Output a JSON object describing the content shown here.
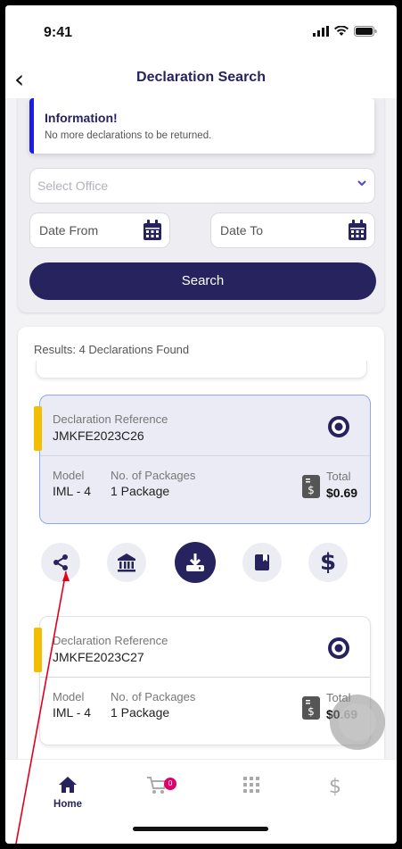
{
  "status": {
    "time": "9:41"
  },
  "nav": {
    "title": "Declaration Search",
    "back_icon": "chevron-left-icon"
  },
  "info": {
    "title": "Information!",
    "message": "No more declarations to be returned."
  },
  "form": {
    "office_placeholder": "Select Office",
    "date_from_placeholder": "Date From",
    "date_to_placeholder": "Date To",
    "search_label": "Search"
  },
  "results": {
    "summary": "Results: 4 Declarations Found",
    "cards": [
      {
        "reference_label": "Declaration Reference",
        "reference": "JMKFE2023C26",
        "model_label": "Model",
        "model": "IML - 4",
        "packages_label": "No. of Packages",
        "packages": "1 Package",
        "total_label": "Total",
        "total": "$0.69",
        "selected": true
      },
      {
        "reference_label": "Declaration Reference",
        "reference": "JMKFE2023C27",
        "model_label": "Model",
        "model": "IML - 4",
        "packages_label": "No. of Packages",
        "packages": "1 Package",
        "total_label": "Total",
        "total": "$0.69",
        "selected": false
      }
    ],
    "actions": [
      "share-icon",
      "bank-icon",
      "download-icon",
      "book-icon",
      "dollar-icon"
    ]
  },
  "tabbar": {
    "home_label": "Home",
    "cart_badge": "0",
    "icons": [
      "home-icon",
      "cart-icon",
      "grid-icon",
      "dollar-icon"
    ]
  },
  "colors": {
    "primary": "#26235f",
    "accent": "#f1be00",
    "info_bar": "#1c1ce8",
    "badge": "#e0006a",
    "annotation": "#e0001b"
  }
}
